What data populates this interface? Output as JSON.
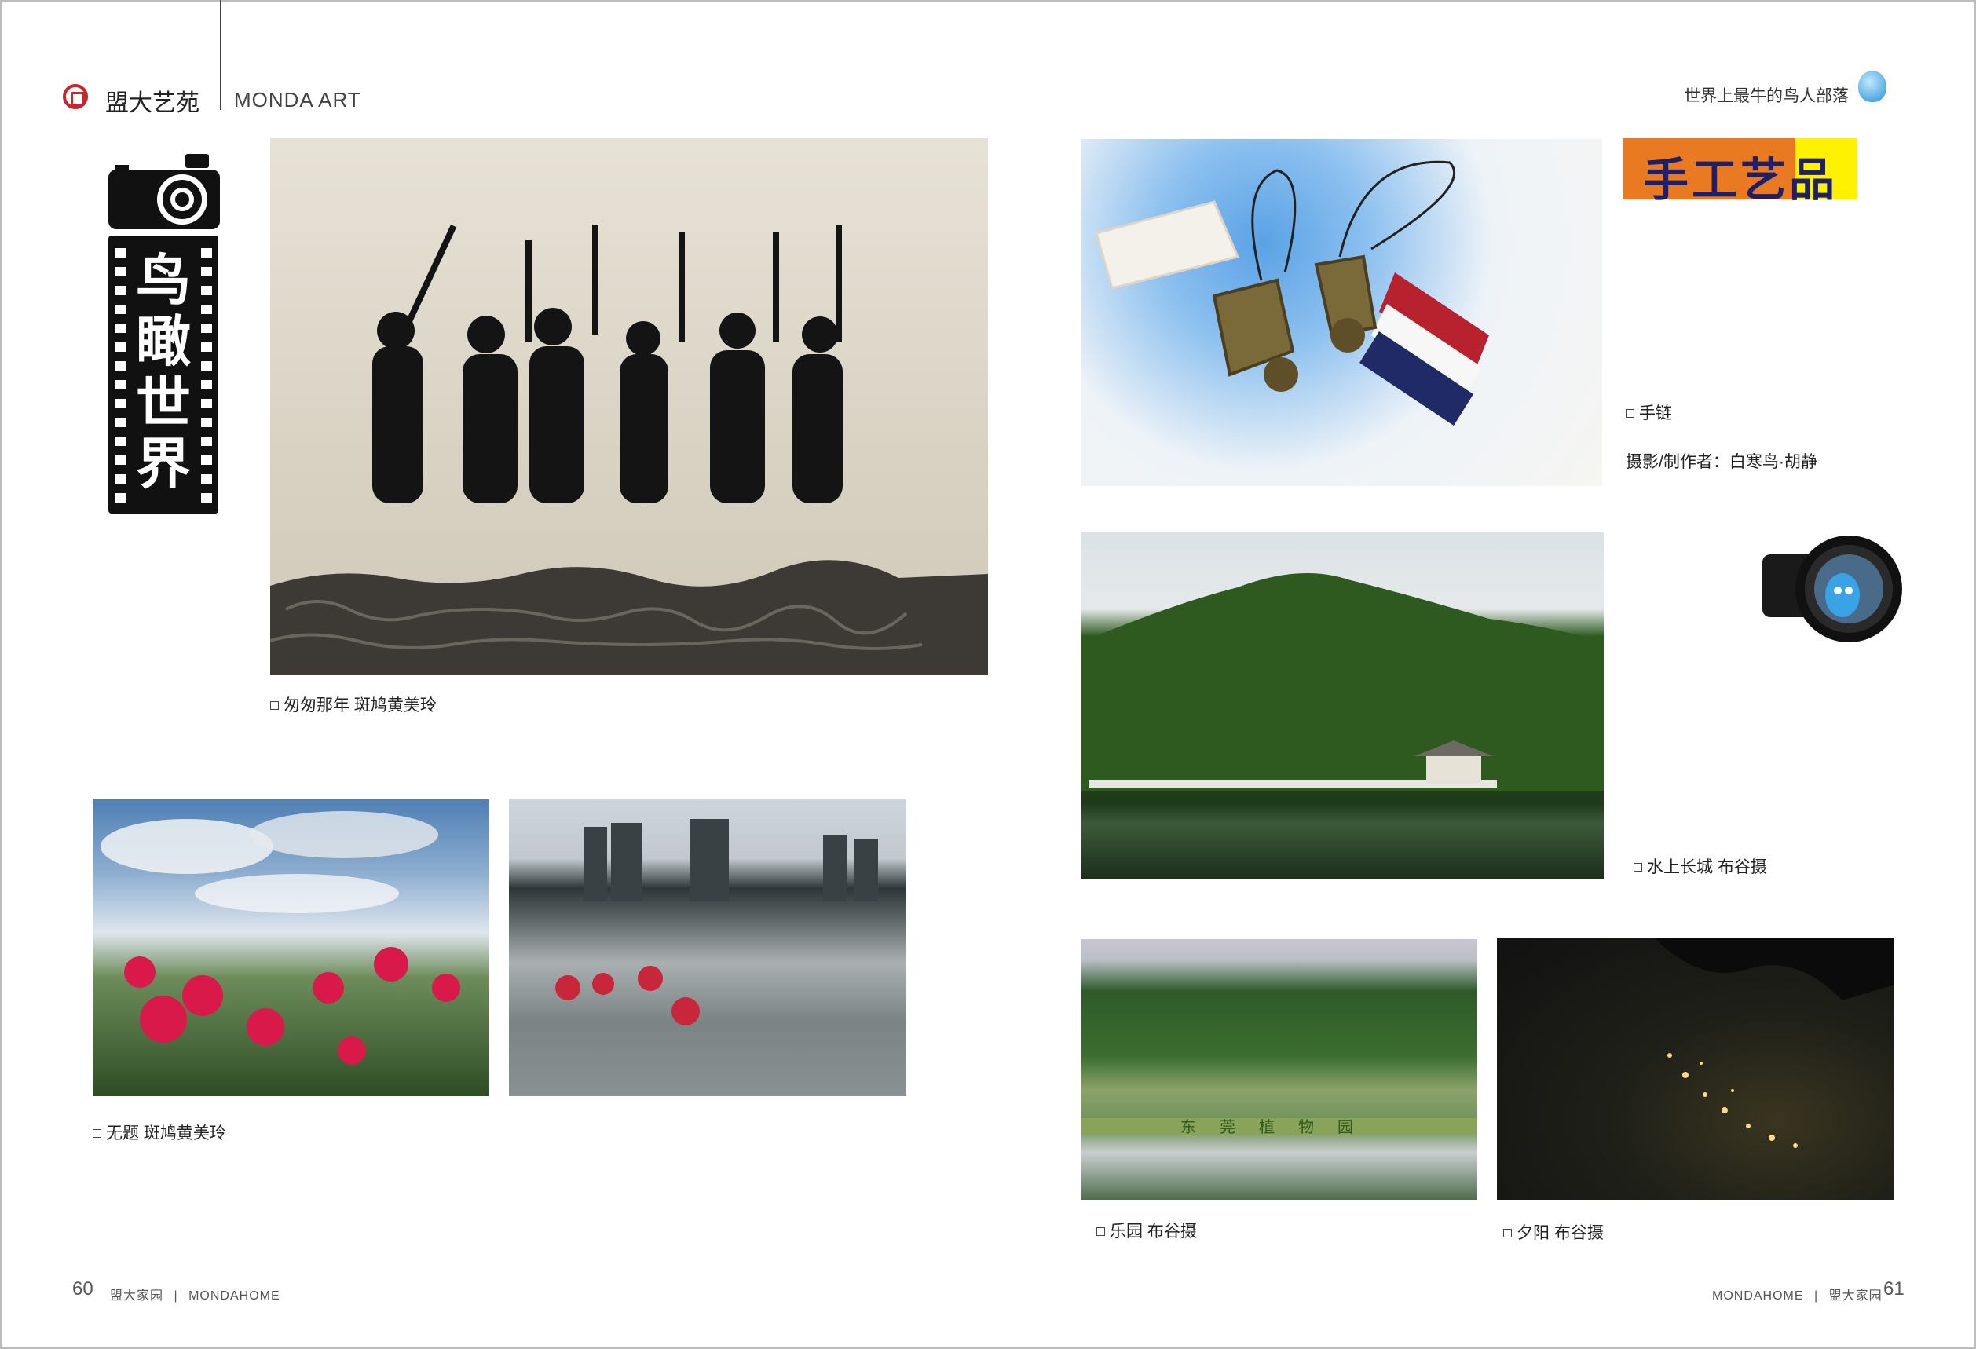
{
  "header": {
    "brand_cn": "盟大艺苑",
    "brand_en": "MONDA ART",
    "tagline": "世界上最牛的鸟人部落"
  },
  "section_title": "鸟瞰世界",
  "craft_title": "手工艺品",
  "captions": {
    "silhouette": "匆匆那年  斑鸠黄美玲",
    "flowers": "无题  斑鸠黄美玲",
    "bracelet": "手链",
    "bracelet_credit": "摄影/制作者：白寒鸟·胡静",
    "lake": "水上长城  布谷摄",
    "park": "乐园  布谷摄",
    "sunset": "夕阳  布谷摄"
  },
  "footer": {
    "left_page": "60",
    "left_brand_cn": "盟大家园",
    "left_brand_en": "MONDAHOME",
    "right_page": "61",
    "right_brand_cn": "盟大家园",
    "right_brand_en": "MONDAHOME"
  },
  "park_sign_text": "东莞植物园",
  "colors": {
    "logo_red": "#c8262c",
    "craft_orange": "#ea7a22",
    "craft_yellow": "#fff200",
    "craft_text": "#1d1f6b"
  }
}
